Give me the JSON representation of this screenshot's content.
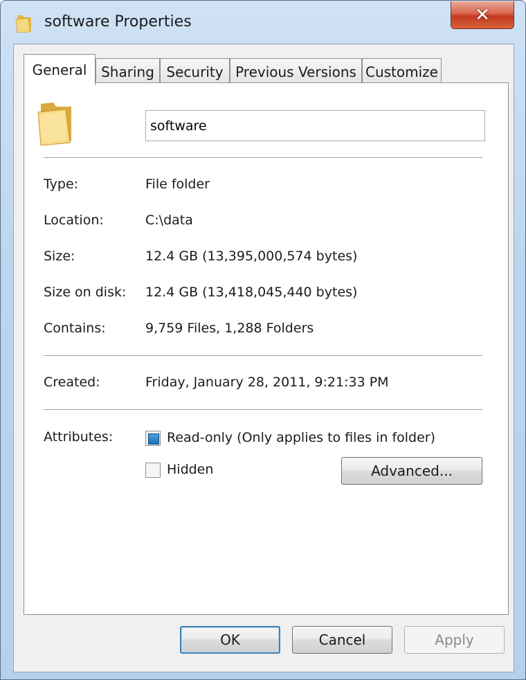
{
  "window": {
    "title": "software Properties",
    "close_glyph": "✕"
  },
  "tabs": [
    {
      "label": "General",
      "active": true
    },
    {
      "label": "Sharing",
      "active": false
    },
    {
      "label": "Security",
      "active": false
    },
    {
      "label": "Previous Versions",
      "active": false
    },
    {
      "label": "Customize",
      "active": false
    }
  ],
  "general": {
    "name_value": "software",
    "rows": [
      {
        "label": "Type:",
        "value": "File folder"
      },
      {
        "label": "Location:",
        "value": "C:\\data"
      },
      {
        "label": "Size:",
        "value": "12.4 GB (13,395,000,574 bytes)"
      },
      {
        "label": "Size on disk:",
        "value": "12.4 GB (13,418,045,440 bytes)"
      },
      {
        "label": "Contains:",
        "value": "9,759 Files, 1,288 Folders"
      }
    ],
    "created_label": "Created:",
    "created_value": "Friday, January 28, 2011, 9:21:33 PM",
    "attributes_label": "Attributes:",
    "readonly_label": "Read-only (Only applies to files in folder)",
    "readonly_checked": true,
    "hidden_label": "Hidden",
    "hidden_checked": false,
    "advanced_label": "Advanced..."
  },
  "footer": {
    "ok_label": "OK",
    "cancel_label": "Cancel",
    "apply_label": "Apply"
  },
  "icons": {
    "title": "folder-icon",
    "large": "folder-icon"
  },
  "colors": {
    "titlebar": "#bcd5ee",
    "close": "#c2391f",
    "default_button_border": "#3c7fb1",
    "checkbox_fill": "#1a6fb3"
  }
}
